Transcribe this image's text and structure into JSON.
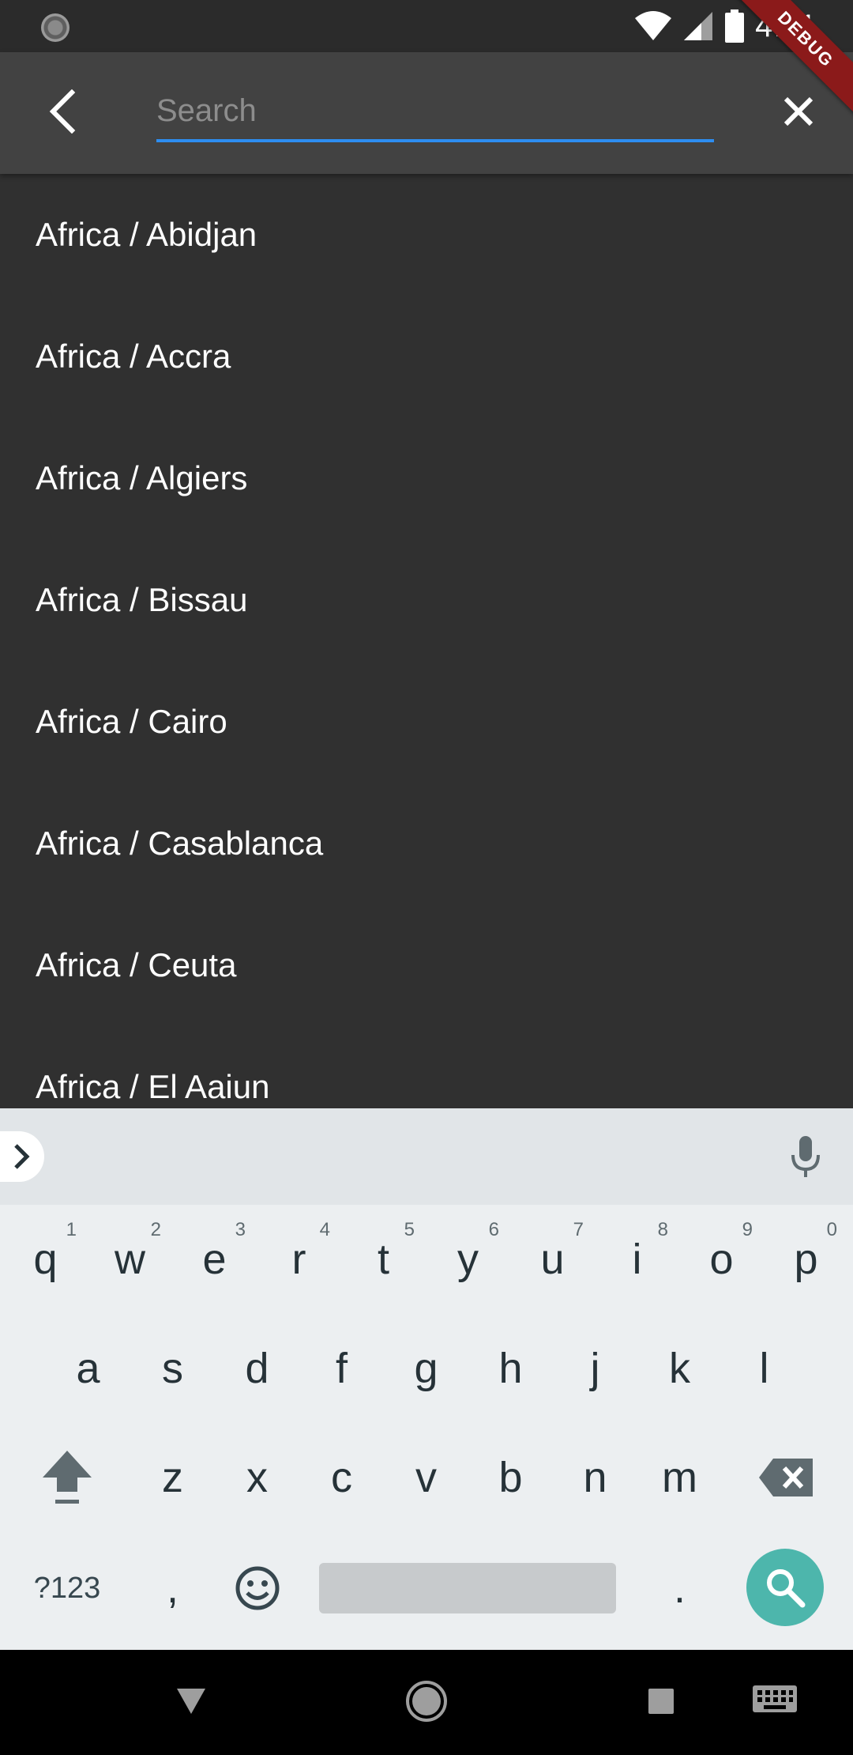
{
  "status_bar": {
    "time": "4:11",
    "icons": [
      "sync-icon",
      "wifi-icon",
      "signal-icon",
      "battery-icon"
    ]
  },
  "debug_banner": "DEBUG",
  "app_bar": {
    "back_icon": "back-chevron-icon",
    "search": {
      "placeholder": "Search",
      "value": ""
    },
    "close_icon": "close-icon",
    "accent_color": "#2d8df0"
  },
  "timezones": [
    "Africa / Abidjan",
    "Africa / Accra",
    "Africa / Algiers",
    "Africa / Bissau",
    "Africa / Cairo",
    "Africa / Casablanca",
    "Africa / Ceuta",
    "Africa / El Aaiun"
  ],
  "keyboard": {
    "row1": [
      {
        "key": "q",
        "hint": "1"
      },
      {
        "key": "w",
        "hint": "2"
      },
      {
        "key": "e",
        "hint": "3"
      },
      {
        "key": "r",
        "hint": "4"
      },
      {
        "key": "t",
        "hint": "5"
      },
      {
        "key": "y",
        "hint": "6"
      },
      {
        "key": "u",
        "hint": "7"
      },
      {
        "key": "i",
        "hint": "8"
      },
      {
        "key": "o",
        "hint": "9"
      },
      {
        "key": "p",
        "hint": "0"
      }
    ],
    "row2": [
      "a",
      "s",
      "d",
      "f",
      "g",
      "h",
      "j",
      "k",
      "l"
    ],
    "row3": [
      "z",
      "x",
      "c",
      "v",
      "b",
      "n",
      "m"
    ],
    "symbols_key": "?123",
    "comma_key": ",",
    "period_key": ".",
    "action_color": "#4db6ac"
  },
  "nav_bar": {
    "icons": [
      "back-triangle-icon",
      "home-icon",
      "recents-icon",
      "keyboard-switch-icon"
    ]
  }
}
